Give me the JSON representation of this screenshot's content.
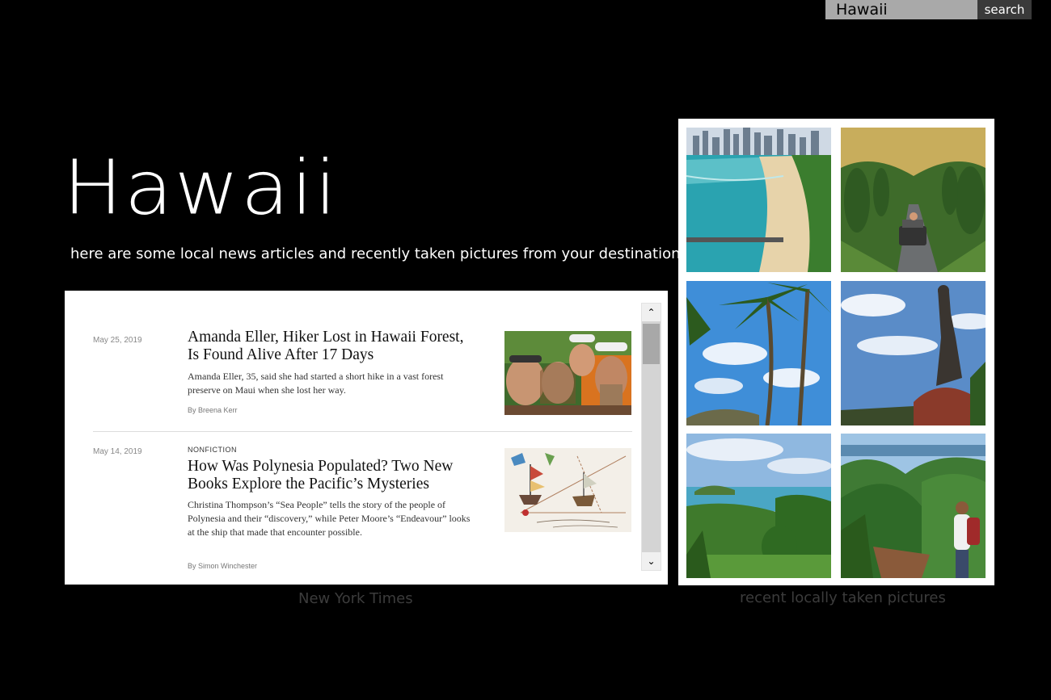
{
  "search": {
    "value": "Hawaii",
    "button_label": "search"
  },
  "page": {
    "title": "Hawaii",
    "subtitle": "here are some local news articles and recently taken pictures from your destination"
  },
  "news": {
    "caption": "New York Times",
    "articles": [
      {
        "date": "May 25, 2019",
        "kicker": "",
        "headline": "Amanda Eller, Hiker Lost in Hawaii Forest, Is Found Alive After 17 Days",
        "summary": "Amanda Eller, 35, said she had started a short hike in a vast forest preserve on Maui when she lost her way.",
        "byline": "By Breena Kerr"
      },
      {
        "date": "May 14, 2019",
        "kicker": "NONFICTION",
        "headline": "How Was Polynesia Populated? Two New Books Explore the Pacific’s Mysteries",
        "summary": "Christina Thompson’s “Sea People” tells the story of the people of Polynesia and their “discovery,” while Peter Moore’s “Endeavour” looks at the ship that made that encounter possible.",
        "byline": "By Simon Winchester"
      }
    ]
  },
  "photos": {
    "caption": "recent locally taken pictures",
    "items": [
      {
        "icon": "beach-city-photo"
      },
      {
        "icon": "jeep-road-photo"
      },
      {
        "icon": "palm-trees-photo"
      },
      {
        "icon": "buddha-statue-photo"
      },
      {
        "icon": "coast-view-photo"
      },
      {
        "icon": "mountain-hike-photo"
      }
    ]
  },
  "colors": {
    "background": "#000000",
    "search_field": "#a9a9a9",
    "search_button": "#3a3a3a",
    "caption": "#3c3c3c"
  }
}
